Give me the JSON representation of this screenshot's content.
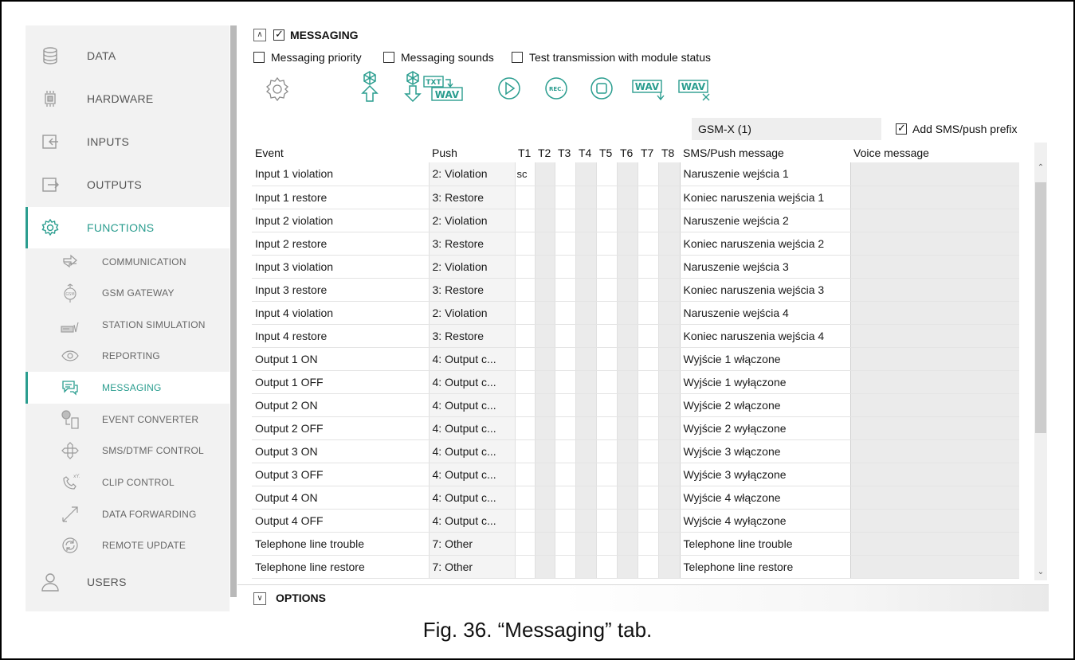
{
  "sidebar": {
    "main_items": [
      {
        "label": "DATA",
        "icon": "database-icon"
      },
      {
        "label": "HARDWARE",
        "icon": "chip-icon"
      },
      {
        "label": "INPUTS",
        "icon": "inputs-icon"
      },
      {
        "label": "OUTPUTS",
        "icon": "outputs-icon"
      },
      {
        "label": "FUNCTIONS",
        "icon": "gear-icon"
      },
      {
        "label": "USERS",
        "icon": "user-icon"
      }
    ],
    "sub_items": [
      {
        "label": "COMMUNICATION",
        "icon": "communication-icon"
      },
      {
        "label": "GSM GATEWAY",
        "icon": "gsm-gateway-icon"
      },
      {
        "label": "STATION SIMULATION",
        "icon": "station-icon"
      },
      {
        "label": "REPORTING",
        "icon": "eye-icon"
      },
      {
        "label": "MESSAGING",
        "icon": "message-icon"
      },
      {
        "label": "EVENT CONVERTER",
        "icon": "converter-icon"
      },
      {
        "label": "SMS/DTMF CONTROL",
        "icon": "sms-dtmf-icon"
      },
      {
        "label": "CLIP CONTROL",
        "icon": "clip-icon"
      },
      {
        "label": "DATA FORWARDING",
        "icon": "forwarding-icon"
      },
      {
        "label": "REMOTE UPDATE",
        "icon": "update-icon"
      }
    ],
    "active_main": "FUNCTIONS",
    "active_sub": "MESSAGING"
  },
  "messaging": {
    "section_title": "MESSAGING",
    "section_checked": true,
    "options": [
      {
        "label": "Messaging priority",
        "checked": false
      },
      {
        "label": "Messaging sounds",
        "checked": false
      },
      {
        "label": "Test transmission with module status",
        "checked": false
      }
    ],
    "toolbar": {
      "txt_label": "TXT",
      "wav_label": "WAV",
      "rec_label": "REC."
    },
    "module_name": "GSM-X (1)",
    "prefix_label": "Add SMS/push prefix",
    "prefix_checked": true
  },
  "table": {
    "columns": [
      "Event",
      "Push",
      "T1",
      "T2",
      "T3",
      "T4",
      "T5",
      "T6",
      "T7",
      "T8",
      "SMS/Push message",
      "Voice message"
    ],
    "rows": [
      {
        "event": "Input 1 violation",
        "push": "2: Violation",
        "t": [
          "sc",
          "",
          "",
          "",
          "",
          "",
          "",
          ""
        ],
        "sms": "Naruszenie wejścia 1",
        "voice": ""
      },
      {
        "event": "Input 1 restore",
        "push": "3: Restore",
        "t": [
          "",
          "",
          "",
          "",
          "",
          "",
          "",
          ""
        ],
        "sms": "Koniec naruszenia wejścia 1",
        "voice": ""
      },
      {
        "event": "Input 2 violation",
        "push": "2: Violation",
        "t": [
          "",
          "",
          "",
          "",
          "",
          "",
          "",
          ""
        ],
        "sms": "Naruszenie wejścia 2",
        "voice": ""
      },
      {
        "event": "Input 2 restore",
        "push": "3: Restore",
        "t": [
          "",
          "",
          "",
          "",
          "",
          "",
          "",
          ""
        ],
        "sms": "Koniec naruszenia wejścia 2",
        "voice": ""
      },
      {
        "event": "Input 3 violation",
        "push": "2: Violation",
        "t": [
          "",
          "",
          "",
          "",
          "",
          "",
          "",
          ""
        ],
        "sms": "Naruszenie wejścia 3",
        "voice": ""
      },
      {
        "event": "Input 3 restore",
        "push": "3: Restore",
        "t": [
          "",
          "",
          "",
          "",
          "",
          "",
          "",
          ""
        ],
        "sms": "Koniec naruszenia wejścia 3",
        "voice": ""
      },
      {
        "event": "Input 4 violation",
        "push": "2: Violation",
        "t": [
          "",
          "",
          "",
          "",
          "",
          "",
          "",
          ""
        ],
        "sms": "Naruszenie wejścia 4",
        "voice": ""
      },
      {
        "event": "Input 4 restore",
        "push": "3: Restore",
        "t": [
          "",
          "",
          "",
          "",
          "",
          "",
          "",
          ""
        ],
        "sms": "Koniec naruszenia wejścia 4",
        "voice": ""
      },
      {
        "event": "Output 1 ON",
        "push": "4: Output c...",
        "t": [
          "",
          "",
          "",
          "",
          "",
          "",
          "",
          ""
        ],
        "sms": "Wyjście 1 włączone",
        "voice": ""
      },
      {
        "event": "Output 1 OFF",
        "push": "4: Output c...",
        "t": [
          "",
          "",
          "",
          "",
          "",
          "",
          "",
          ""
        ],
        "sms": "Wyjście 1 wyłączone",
        "voice": ""
      },
      {
        "event": "Output 2 ON",
        "push": "4: Output c...",
        "t": [
          "",
          "",
          "",
          "",
          "",
          "",
          "",
          ""
        ],
        "sms": "Wyjście 2 włączone",
        "voice": ""
      },
      {
        "event": "Output 2 OFF",
        "push": "4: Output c...",
        "t": [
          "",
          "",
          "",
          "",
          "",
          "",
          "",
          ""
        ],
        "sms": "Wyjście 2 wyłączone",
        "voice": ""
      },
      {
        "event": "Output 3 ON",
        "push": "4: Output c...",
        "t": [
          "",
          "",
          "",
          "",
          "",
          "",
          "",
          ""
        ],
        "sms": "Wyjście 3 włączone",
        "voice": ""
      },
      {
        "event": "Output 3 OFF",
        "push": "4: Output c...",
        "t": [
          "",
          "",
          "",
          "",
          "",
          "",
          "",
          ""
        ],
        "sms": "Wyjście 3 wyłączone",
        "voice": ""
      },
      {
        "event": "Output 4 ON",
        "push": "4: Output c...",
        "t": [
          "",
          "",
          "",
          "",
          "",
          "",
          "",
          ""
        ],
        "sms": "Wyjście 4 włączone",
        "voice": ""
      },
      {
        "event": "Output 4 OFF",
        "push": "4: Output c...",
        "t": [
          "",
          "",
          "",
          "",
          "",
          "",
          "",
          ""
        ],
        "sms": "Wyjście 4 wyłączone",
        "voice": ""
      },
      {
        "event": "Telephone line trouble",
        "push": "7: Other",
        "t": [
          "",
          "",
          "",
          "",
          "",
          "",
          "",
          ""
        ],
        "sms": "Telephone line trouble",
        "voice": ""
      },
      {
        "event": "Telephone line restore",
        "push": "7: Other",
        "t": [
          "",
          "",
          "",
          "",
          "",
          "",
          "",
          ""
        ],
        "sms": "Telephone line restore",
        "voice": ""
      }
    ]
  },
  "options_section": {
    "title": "OPTIONS"
  },
  "caption": "Fig. 36. “Messaging” tab.",
  "colors": {
    "accent": "#2a9d8f",
    "icon_gray": "#9a9a9a"
  }
}
